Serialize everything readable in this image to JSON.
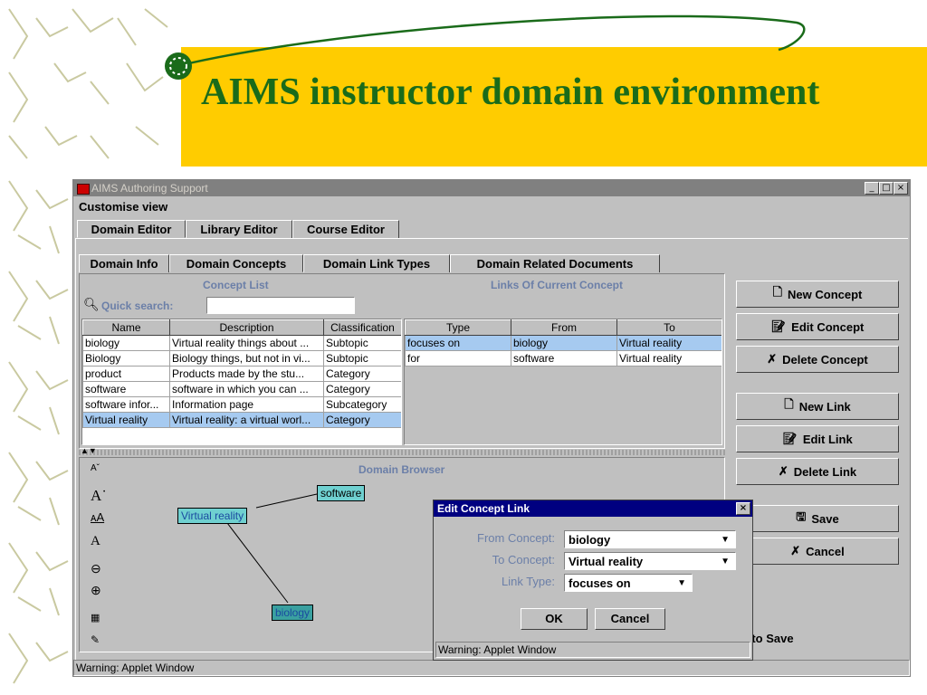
{
  "slide": {
    "title": "AIMS instructor domain environment"
  },
  "window": {
    "title": "AIMS Authoring Support",
    "controls": [
      "_",
      "□",
      "×"
    ]
  },
  "menu": {
    "customise": "Customise view"
  },
  "top_tabs": [
    "Domain Editor",
    "Library Editor",
    "Course Editor"
  ],
  "sub_tabs": [
    "Domain Info",
    "Domain Concepts",
    "Domain Link Types",
    "Domain Related Documents"
  ],
  "concept_list": {
    "title": "Concept List",
    "search_label": "Quick search:",
    "search_value": "",
    "columns": [
      "Name",
      "Description",
      "Classification"
    ],
    "rows": [
      [
        "biology",
        "Virtual reality things about ...",
        "Subtopic"
      ],
      [
        "Biology",
        "Biology things, but not in vi...",
        "Subtopic"
      ],
      [
        "product",
        "Products made by the stu...",
        "Category"
      ],
      [
        "software",
        "software in which you can ...",
        "Category"
      ],
      [
        "software infor...",
        "Information page",
        "Subcategory"
      ],
      [
        "Virtual reality",
        "Virtual reality: a virtual worl...",
        "Category"
      ]
    ],
    "selected_row": 5
  },
  "links": {
    "title": "Links Of Current Concept",
    "columns": [
      "Type",
      "From",
      "To"
    ],
    "rows": [
      [
        "focuses on",
        "biology",
        "Virtual reality"
      ],
      [
        "for",
        "software",
        "Virtual reality"
      ]
    ],
    "selected_row": 0
  },
  "buttons": {
    "new_concept": "New Concept",
    "edit_concept": "Edit Concept",
    "delete_concept": "Delete Concept",
    "new_link": "New Link",
    "edit_link": "Edit Link",
    "delete_link": "Delete Link",
    "save": "Save",
    "cancel": "Cancel",
    "auto_save": "Auto Save"
  },
  "browser": {
    "title": "Domain Browser",
    "nodes": [
      "software",
      "Virtual reality",
      "biology"
    ]
  },
  "dialog": {
    "title": "Edit Concept Link",
    "from_label": "From Concept:",
    "from_value": "biology",
    "to_label": "To Concept:",
    "to_value": "Virtual reality",
    "type_label": "Link Type:",
    "type_value": "focuses on",
    "ok": "OK",
    "cancel": "Cancel",
    "warning": "Warning: Applet Window"
  },
  "status": {
    "warning": "Warning: Applet Window"
  },
  "colors": {
    "banner": "#ffcc00",
    "title": "#1a6b1a",
    "selection": "#a6caf0",
    "node": "#6fd0d0"
  }
}
